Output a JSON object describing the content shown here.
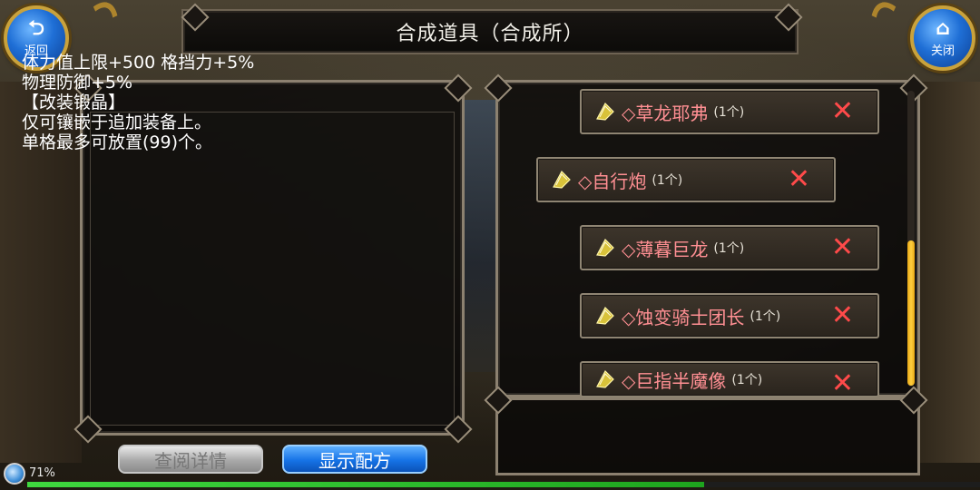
{
  "title": "合成道具（合成所）",
  "back_button": {
    "label": "返回",
    "icon": "back-arrow-icon"
  },
  "close_button": {
    "label": "关闭",
    "icon": "home-icon"
  },
  "description": {
    "lines": [
      "体力值上限+500 格挡力+5%",
      "物理防御+5%",
      "",
      "【改装锻晶】",
      "仅可镶嵌于追加装备上。",
      "单格最多可放置(99)个。"
    ]
  },
  "items": [
    {
      "name": "◇草龙耶弗",
      "count": "(1个)"
    },
    {
      "name": "◇自行炮",
      "count": "(1个)"
    },
    {
      "name": "◇薄暮巨龙",
      "count": "(1个)"
    },
    {
      "name": "◇蚀变骑士团长",
      "count": "(1个)"
    },
    {
      "name": "◇巨指半魔像",
      "count": "(1个)"
    }
  ],
  "buttons": {
    "view_details": "查阅详情",
    "show_recipe": "显示配方"
  },
  "status": {
    "battery_text": "71%",
    "battery_fraction": 0.71
  },
  "colors": {
    "item_name": "#ff8f93",
    "remove_x": "#ff4a4a",
    "scroll_thumb": "#ffcf3f",
    "blue_button": "#1673e6"
  }
}
